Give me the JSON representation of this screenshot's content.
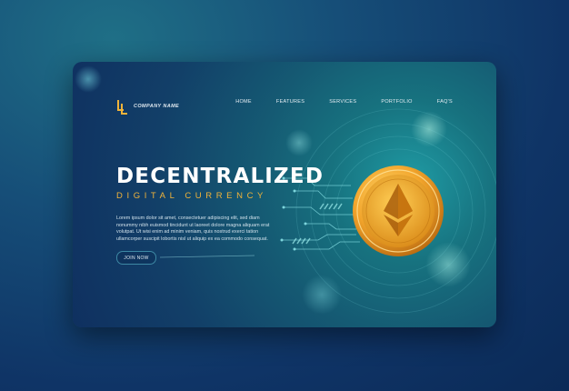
{
  "brand": {
    "company_name": "COMPANY NAME"
  },
  "nav": {
    "items": [
      {
        "label": "HOME"
      },
      {
        "label": "FEATURES"
      },
      {
        "label": "SERVICES"
      },
      {
        "label": "PORTFOLIO"
      },
      {
        "label": "FAQ'S"
      }
    ]
  },
  "hero": {
    "title": "DECENTRALIZED",
    "subtitle": "DIGITAL CURRENCY",
    "body": "Lorem ipsum dolor sit amet, consectetuer adipiscing elit, sed diam nonummy nibh euismod tincidunt ut laoreet dolore magna aliquam erat volutpat. Ut wisi enim ad minim veniam, quis nostrud exerci tation ullamcorper suscipit lobortis nisl ut aliquip ex ea commodo consequat.",
    "cta_label": "JOIN NOW"
  },
  "colors": {
    "accent_gold": "#f0b33a",
    "background_navy": "#0f3466",
    "card_teal": "#17727f"
  },
  "icons": {
    "logo": "company-logo-icon",
    "coin": "ethereum-coin-icon"
  }
}
